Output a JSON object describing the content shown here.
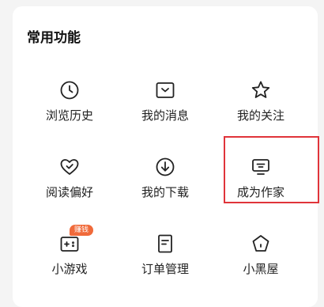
{
  "section": {
    "title": "常用功能"
  },
  "items": [
    {
      "label": "浏览历史",
      "icon": "clock-icon"
    },
    {
      "label": "我的消息",
      "icon": "message-box-icon"
    },
    {
      "label": "我的关注",
      "icon": "star-icon"
    },
    {
      "label": "阅读偏好",
      "icon": "heart-check-icon"
    },
    {
      "label": "我的下载",
      "icon": "download-icon"
    },
    {
      "label": "成为作家",
      "icon": "monitor-icon"
    },
    {
      "label": "小游戏",
      "icon": "gamepad-icon",
      "badge": "赚钱"
    },
    {
      "label": "订单管理",
      "icon": "order-document-icon"
    },
    {
      "label": "小黑屋",
      "icon": "pentagon-icon"
    }
  ],
  "colors": {
    "badge": "#f06a3a",
    "highlight_border": "#e0343a",
    "icon_stroke": "#222222"
  }
}
